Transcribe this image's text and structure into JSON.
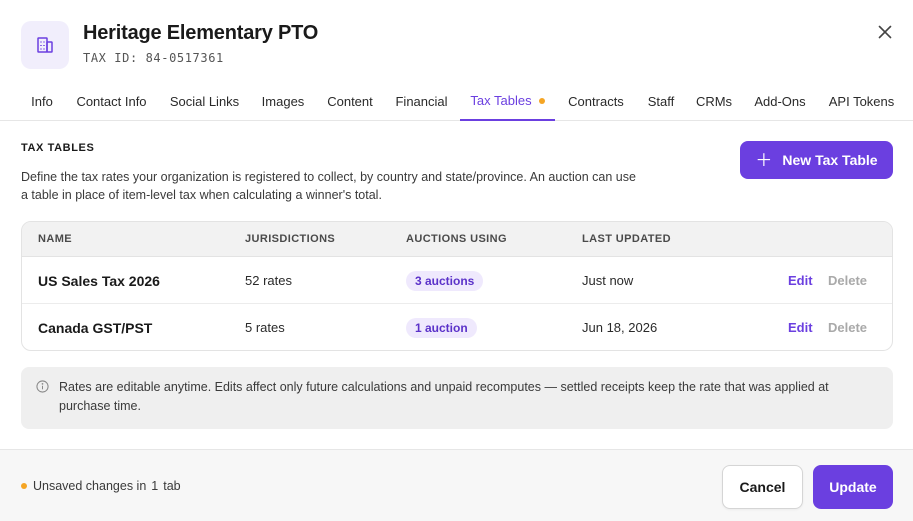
{
  "colors": {
    "accent": "#6b3fe0",
    "accent_soft": "#efe9fd",
    "warning_dot": "#f5a524",
    "muted": "#a9a9a9"
  },
  "header": {
    "org_name": "Heritage Elementary PTO",
    "tax_id": "TAX ID: 84-0517361",
    "logo_icon": "building-icon",
    "close_icon": "close-icon"
  },
  "tabs": [
    {
      "label": "Info"
    },
    {
      "label": "Contact Info"
    },
    {
      "label": "Social Links"
    },
    {
      "label": "Images"
    },
    {
      "label": "Content"
    },
    {
      "label": "Financial"
    },
    {
      "label": "Tax Tables",
      "active": true,
      "unsaved": true
    },
    {
      "label": "Contracts"
    },
    {
      "label": "Staff"
    },
    {
      "label": "CRMs"
    },
    {
      "label": "Add-Ons"
    },
    {
      "label": "API Tokens"
    }
  ],
  "section": {
    "title": "TAX TABLES",
    "description": "Define the tax rates your organization is registered to collect, by country and state/province. An auction can use a table in place of item-level tax when calculating a winner's total.",
    "new_button_label": "New Tax Table",
    "new_button_icon": "plus-icon"
  },
  "table": {
    "columns": [
      "NAME",
      "JURISDICTIONS",
      "AUCTIONS USING",
      "LAST UPDATED"
    ],
    "rows": [
      {
        "name": "US Sales Tax 2026",
        "jurisdictions": "52 rates",
        "auctions": "3 auctions",
        "updated": "Just now",
        "edit": "Edit",
        "delete": "Delete"
      },
      {
        "name": "Canada GST/PST",
        "jurisdictions": "5 rates",
        "auctions": "1 auction",
        "updated": "Jun 18, 2026",
        "edit": "Edit",
        "delete": "Delete"
      }
    ]
  },
  "info": {
    "icon": "info-icon",
    "text": "Rates are editable anytime. Edits affect only future calculations and unpaid recomputes — settled receipts keep the rate that was applied at purchase time."
  },
  "footer": {
    "unsaved_prefix": "Unsaved changes in",
    "unsaved_count": "1",
    "unsaved_suffix": "tab",
    "cancel_label": "Cancel",
    "update_label": "Update"
  }
}
